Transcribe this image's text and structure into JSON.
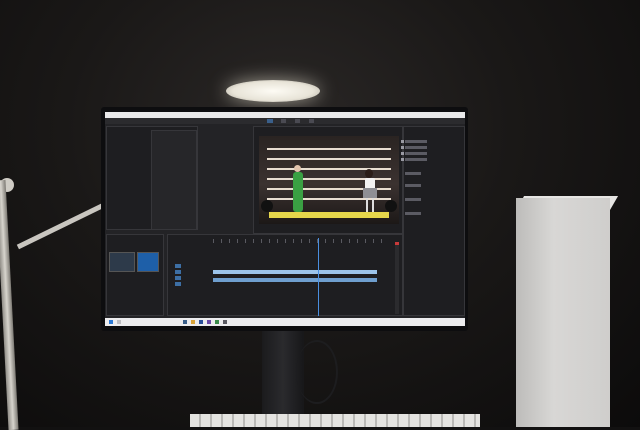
{
  "scene": {
    "wall_color": "#1a1817",
    "lamp_light_color": "#fdfbf4",
    "box_color": "#d8d7d5"
  },
  "app": {
    "titlebar": "",
    "tabs": [
      {
        "label": "",
        "active": false
      },
      {
        "label": "",
        "active": true
      },
      {
        "label": "",
        "active": false
      },
      {
        "label": "",
        "active": false
      },
      {
        "label": "",
        "active": false
      }
    ],
    "project_panel": {
      "label": ""
    },
    "source_panel": {
      "label": ""
    },
    "program_monitor": {
      "label": ""
    },
    "timeline_panel": {
      "label": ""
    },
    "effects_panel": {
      "label": ""
    }
  },
  "icons": {
    "lamp": "desk-lamp-icon",
    "play": "play-icon",
    "taskbar_start": "windows-start-icon"
  },
  "colors": {
    "accent": "#4a8fe0",
    "clip": "#6f9fcf",
    "stage": "#e5d64b",
    "dancer_outfit": "#3aa043"
  }
}
